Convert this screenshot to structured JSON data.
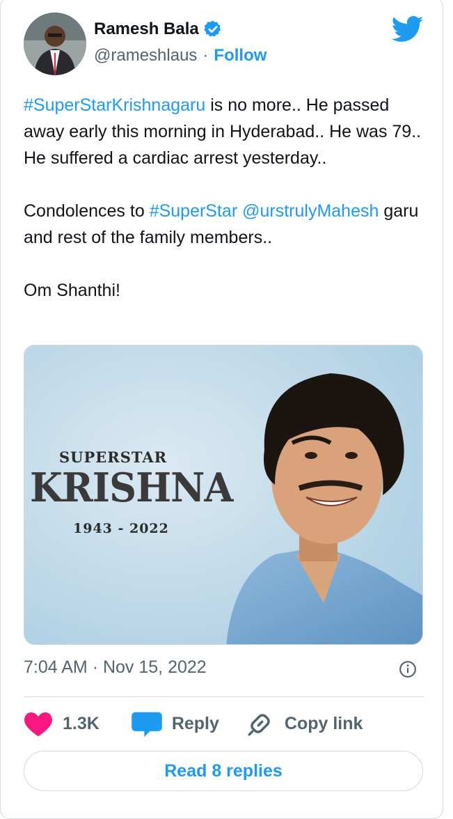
{
  "author": {
    "name": "Ramesh Bala",
    "handle": "@rameshlaus",
    "separator": "·",
    "follow_label": "Follow",
    "verified": true
  },
  "tweet": {
    "p1_hashtag": "#SuperStarKrishnagaru",
    "p1_rest": " is no more.. He passed away early this morning in Hyderabad.. He was 79.. He suffered a cardiac arrest yesterday..",
    "p2_start": "Condolences to ",
    "p2_hashtag": "#SuperStar",
    "p2_space": " ",
    "p2_mention": "@urstrulyMahesh",
    "p2_end": " garu and rest of the family members..",
    "p3": "Om Shanthi!"
  },
  "media": {
    "line1": "SUPERSTAR",
    "line2": "KRISHNA",
    "line3": "1943 - 2022"
  },
  "meta": {
    "time": "7:04 AM",
    "separator": "·",
    "date": "Nov 15, 2022"
  },
  "actions": {
    "likes": "1.3K",
    "reply_label": "Reply",
    "copy_label": "Copy link"
  },
  "read_replies_label": "Read 8 replies",
  "colors": {
    "accent": "#1d9bf0",
    "like": "#f91880",
    "text": "#0f1419",
    "muted": "#536471"
  },
  "icons": [
    "verified-badge-icon",
    "twitter-bird-icon",
    "info-icon",
    "heart-icon",
    "reply-bubble-icon",
    "link-icon"
  ]
}
